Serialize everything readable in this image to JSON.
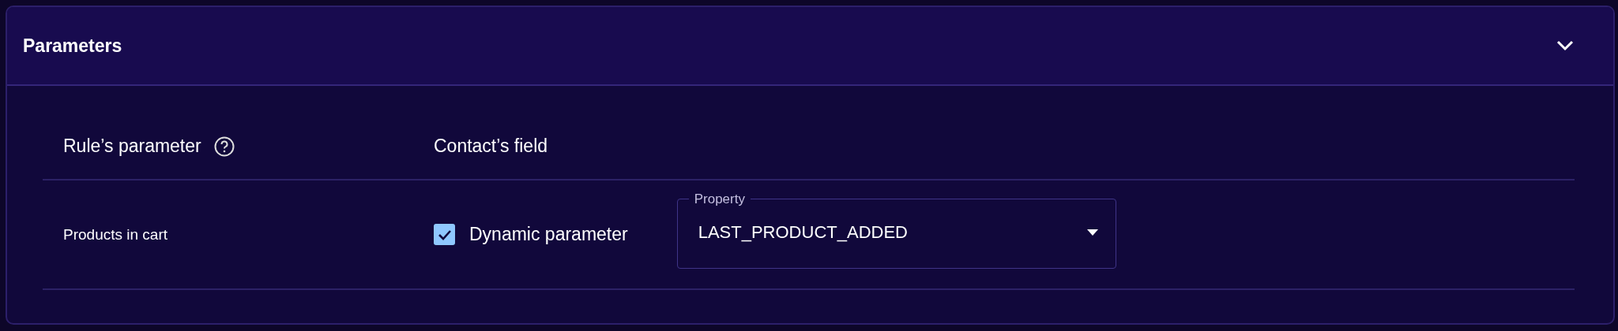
{
  "panel": {
    "title": "Parameters",
    "expanded": true
  },
  "columns": [
    "Rule’s parameter",
    "Contact’s field"
  ],
  "rows": [
    {
      "parameter": "Products in cart",
      "dynamic": {
        "label": "Dynamic parameter",
        "checked": true
      },
      "field": {
        "label": "Property",
        "value": "LAST_PRODUCT_ADDED"
      }
    }
  ]
}
